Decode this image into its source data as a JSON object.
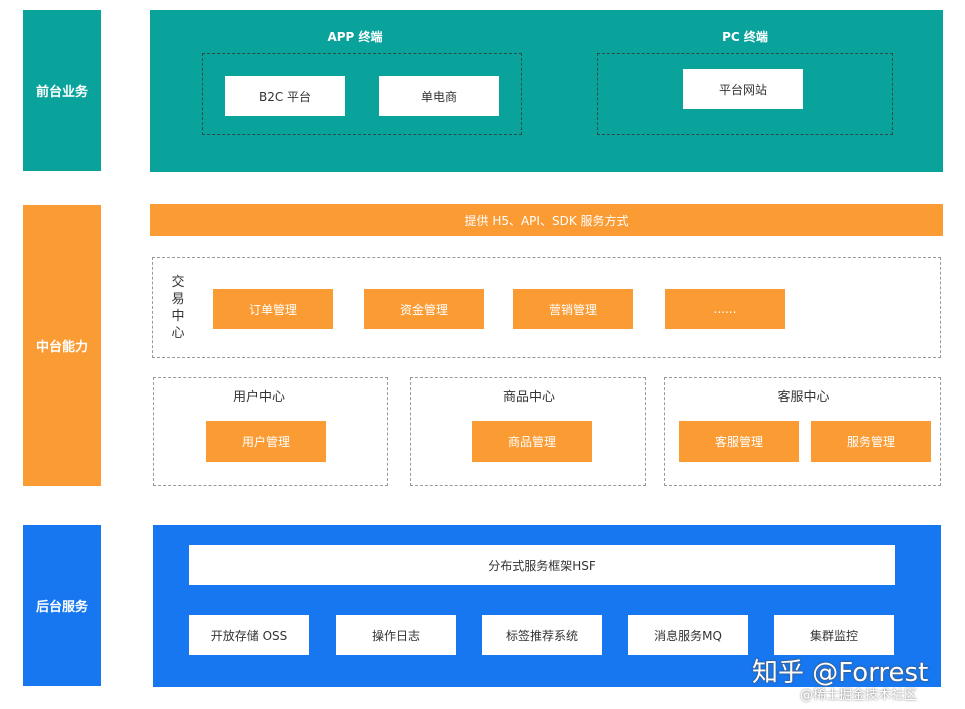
{
  "layers": {
    "front": {
      "label": "前台业务",
      "app": {
        "title": "APP 终端",
        "items": [
          "B2C 平台",
          "单电商"
        ]
      },
      "pc": {
        "title": "PC 终端",
        "items": [
          "平台网站"
        ]
      }
    },
    "middle": {
      "label": "中台能力",
      "banner": "提供 H5、API、SDK 服务方式",
      "trade": {
        "title_chars": [
          "交",
          "易",
          "中",
          "心"
        ],
        "items": [
          "订单管理",
          "资金管理",
          "营销管理",
          "......"
        ]
      },
      "user": {
        "title": "用户中心",
        "items": [
          "用户管理"
        ]
      },
      "goods": {
        "title": "商品中心",
        "items": [
          "商品管理"
        ]
      },
      "service": {
        "title": "客服中心",
        "items": [
          "客服管理",
          "服务管理"
        ]
      }
    },
    "back": {
      "label": "后台服务",
      "framework": "分布式服务框架HSF",
      "items": [
        "开放存储 OSS",
        "操作日志",
        "标签推荐系统",
        "消息服务MQ",
        "集群监控"
      ]
    }
  },
  "watermark": {
    "main": "知乎 @Forrest",
    "sub": "@稀土掘金技术社区"
  },
  "colors": {
    "front": "#0aa39c",
    "middle": "#fb9b34",
    "back": "#1677f0"
  }
}
